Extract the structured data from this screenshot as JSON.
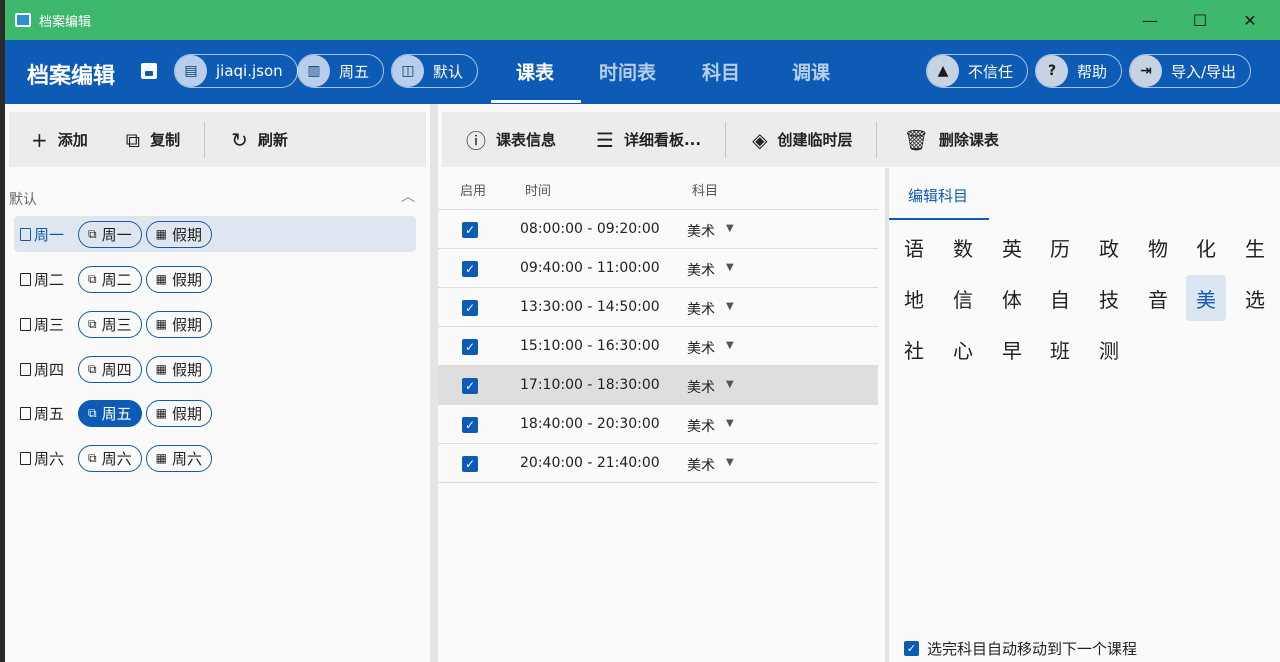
{
  "window": {
    "title": "档案编辑",
    "minimize": "—",
    "maximize": "☐",
    "close": "✕"
  },
  "header": {
    "title": "档案编辑",
    "file_pill": "jiaqi.json",
    "day_pill": "周五",
    "default_pill": "默认",
    "tabs": [
      "课表",
      "时间表",
      "科目",
      "调课"
    ],
    "active_tab": "课表",
    "untrusted": "不信任",
    "help": "帮助",
    "import_export": "导入/导出"
  },
  "left_toolbar": {
    "add": "添加",
    "copy": "复制",
    "refresh": "刷新"
  },
  "schedule_group": "默认",
  "days": [
    {
      "name": "周一",
      "time_chip": "周一",
      "holiday_chip": "假期"
    },
    {
      "name": "周二",
      "time_chip": "周二",
      "holiday_chip": "假期"
    },
    {
      "name": "周三",
      "time_chip": "周三",
      "holiday_chip": "假期"
    },
    {
      "name": "周四",
      "time_chip": "周四",
      "holiday_chip": "假期"
    },
    {
      "name": "周五",
      "time_chip": "周五",
      "holiday_chip": "假期"
    },
    {
      "name": "周六",
      "time_chip": "周六",
      "holiday_chip": "周六"
    }
  ],
  "center_toolbar": {
    "info": "课表信息",
    "details": "详细看板...",
    "temp_layer": "创建临时层",
    "delete": "删除课表"
  },
  "table": {
    "headers": {
      "enabled": "启用",
      "time": "时间",
      "subject": "科目"
    },
    "rows": [
      {
        "time": "08:00:00 - 09:20:00",
        "subject": "美术"
      },
      {
        "time": "09:40:00 - 11:00:00",
        "subject": "美术"
      },
      {
        "time": "13:30:00 - 14:50:00",
        "subject": "美术"
      },
      {
        "time": "15:10:00 - 16:30:00",
        "subject": "美术"
      },
      {
        "time": "17:10:00 - 18:30:00",
        "subject": "美术"
      },
      {
        "time": "18:40:00 - 20:30:00",
        "subject": "美术"
      },
      {
        "time": "20:40:00 - 21:40:00",
        "subject": "美术"
      }
    ]
  },
  "editor": {
    "tab": "编辑科目",
    "subjects": [
      "语",
      "数",
      "英",
      "历",
      "政",
      "物",
      "化",
      "生",
      "地",
      "信",
      "体",
      "自",
      "技",
      "音",
      "美",
      "选",
      "社",
      "心",
      "早",
      "班",
      "测"
    ],
    "selected_subject": "美",
    "auto_move": "选完科目自动移动到下一个课程"
  },
  "colors": {
    "titlebar": "#3db86c",
    "header": "#0d5bb5",
    "accent": "#0d5bb5"
  }
}
